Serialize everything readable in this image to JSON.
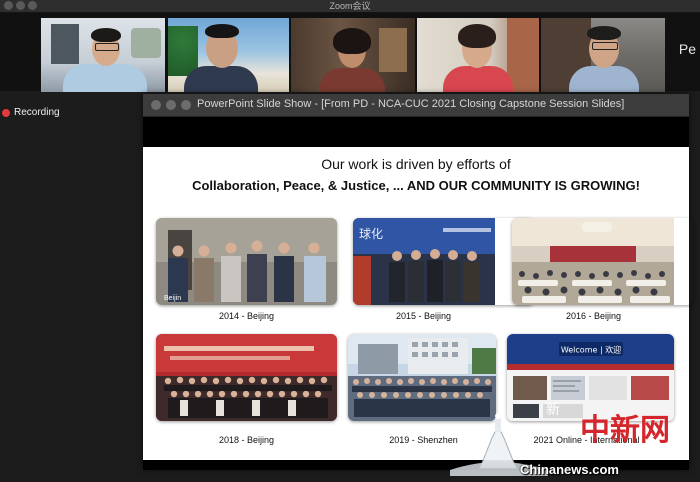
{
  "window": {
    "title": "Zoom会议"
  },
  "gallery": {
    "participants": [
      {
        "id": "p1",
        "active": true
      },
      {
        "id": "p2",
        "active": false
      },
      {
        "id": "p3",
        "active": false
      },
      {
        "id": "p4",
        "active": false
      },
      {
        "id": "p5",
        "active": false
      }
    ],
    "overflow_label": "Pe"
  },
  "recording": {
    "label": "Recording",
    "color": "#e23b3b"
  },
  "slideshow": {
    "title": "PowerPoint Slide Show - [From PD - NCA-CUC 2021 Closing Capstone Session Slides]",
    "slide": {
      "heading": "Our work is driven by efforts of",
      "subheading": "Collaboration, Peace, & Justice, ... AND OUR COMMUNITY IS GROWING!",
      "photos": [
        {
          "caption": "2014 - Beijing",
          "sign": "Beijin"
        },
        {
          "caption": "2015 - Beijing",
          "banner": "球化"
        },
        {
          "caption": "2016 - Beijing"
        },
        {
          "caption": "2018 - Beijing"
        },
        {
          "caption": "2019 - Shenzhen"
        },
        {
          "caption": "2021 Online - International",
          "banner": "Welcome | 欢迎"
        }
      ]
    }
  },
  "watermark": {
    "brand_cn": "中新网",
    "char": "新",
    "url": "Chinanews.com",
    "brand_color": "#d4262c"
  }
}
